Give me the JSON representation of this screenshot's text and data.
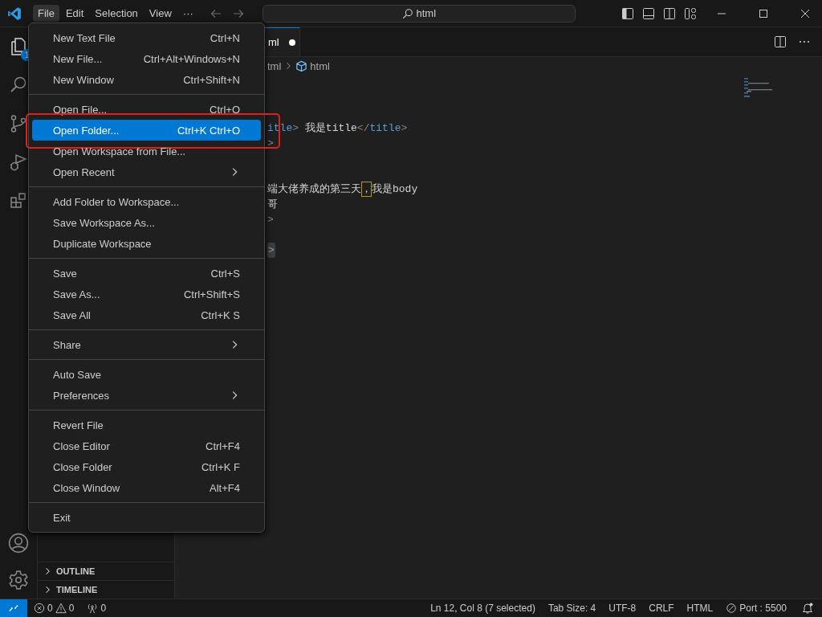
{
  "title_bar": {
    "menus": [
      {
        "label": "File",
        "selected": true
      },
      {
        "label": "Edit",
        "selected": false
      },
      {
        "label": "Selection",
        "selected": false
      },
      {
        "label": "View",
        "selected": false
      }
    ],
    "more": "···",
    "search": {
      "value": "html"
    }
  },
  "activity_bar": {
    "explorer_badge": "1"
  },
  "sidebar": {
    "sections": [
      {
        "label": "OUTLINE",
        "expanded": false
      },
      {
        "label": "TIMELINE",
        "expanded": false
      }
    ]
  },
  "editor": {
    "tab": {
      "label": "ml",
      "modified": true
    },
    "breadcrumb": [
      "tml",
      "html"
    ],
    "lines": [
      {
        "tokens": [
          {
            "text": "itle",
            "kind": "tag"
          },
          {
            "text": ">",
            "kind": "punct"
          },
          {
            "text": " 我是title",
            "kind": "text"
          },
          {
            "text": "</",
            "kind": "punct"
          },
          {
            "text": "title",
            "kind": "tag"
          },
          {
            "text": ">",
            "kind": "punct"
          }
        ]
      },
      {
        "tokens": [
          {
            "text": ">",
            "kind": "punct"
          }
        ]
      },
      {
        "tokens": [
          {
            "text": "端大佬养成的第三天",
            "kind": "text"
          },
          {
            "text": "，",
            "kind": "match"
          },
          {
            "text": "我是body",
            "kind": "text"
          }
        ]
      },
      {
        "tokens": [
          {
            "text": "哥",
            "kind": "text"
          }
        ]
      },
      {
        "tokens": [
          {
            "text": ">",
            "kind": "punct"
          }
        ]
      },
      {
        "tokens": [
          {
            "text": ">",
            "kind": "fold"
          }
        ]
      }
    ]
  },
  "file_menu": {
    "items": [
      {
        "kind": "item",
        "label": "New Text File",
        "shortcut": "Ctrl+N",
        "submenu": false,
        "selected": false,
        "outlined": false
      },
      {
        "kind": "item",
        "label": "New File...",
        "shortcut": "Ctrl+Alt+Windows+N",
        "submenu": false,
        "selected": false,
        "outlined": false
      },
      {
        "kind": "item",
        "label": "New Window",
        "shortcut": "Ctrl+Shift+N",
        "submenu": false,
        "selected": false,
        "outlined": false
      },
      {
        "kind": "separator"
      },
      {
        "kind": "item",
        "label": "Open File...",
        "shortcut": "Ctrl+O",
        "submenu": false,
        "selected": false,
        "outlined": false
      },
      {
        "kind": "item",
        "label": "Open Folder...",
        "shortcut": "Ctrl+K Ctrl+O",
        "submenu": false,
        "selected": true,
        "outlined": true
      },
      {
        "kind": "item",
        "label": "Open Workspace from File...",
        "submenu": false,
        "selected": false,
        "outlined": false
      },
      {
        "kind": "item",
        "label": "Open Recent",
        "submenu": true,
        "selected": false,
        "outlined": false
      },
      {
        "kind": "separator"
      },
      {
        "kind": "item",
        "label": "Add Folder to Workspace...",
        "submenu": false,
        "selected": false,
        "outlined": false
      },
      {
        "kind": "item",
        "label": "Save Workspace As...",
        "submenu": false,
        "selected": false,
        "outlined": false
      },
      {
        "kind": "item",
        "label": "Duplicate Workspace",
        "submenu": false,
        "selected": false,
        "outlined": false
      },
      {
        "kind": "separator"
      },
      {
        "kind": "item",
        "label": "Save",
        "shortcut": "Ctrl+S",
        "submenu": false,
        "selected": false,
        "outlined": false
      },
      {
        "kind": "item",
        "label": "Save As...",
        "shortcut": "Ctrl+Shift+S",
        "submenu": false,
        "selected": false,
        "outlined": false
      },
      {
        "kind": "item",
        "label": "Save All",
        "shortcut": "Ctrl+K S",
        "submenu": false,
        "selected": false,
        "outlined": false
      },
      {
        "kind": "separator"
      },
      {
        "kind": "item",
        "label": "Share",
        "submenu": true,
        "selected": false,
        "outlined": false
      },
      {
        "kind": "separator"
      },
      {
        "kind": "item",
        "label": "Auto Save",
        "submenu": false,
        "selected": false,
        "outlined": false
      },
      {
        "kind": "item",
        "label": "Preferences",
        "submenu": true,
        "selected": false,
        "outlined": false
      },
      {
        "kind": "separator"
      },
      {
        "kind": "item",
        "label": "Revert File",
        "submenu": false,
        "selected": false,
        "outlined": false
      },
      {
        "kind": "item",
        "label": "Close Editor",
        "shortcut": "Ctrl+F4",
        "submenu": false,
        "selected": false,
        "outlined": false
      },
      {
        "kind": "item",
        "label": "Close Folder",
        "shortcut": "Ctrl+K F",
        "submenu": false,
        "selected": false,
        "outlined": false
      },
      {
        "kind": "item",
        "label": "Close Window",
        "shortcut": "Alt+F4",
        "submenu": false,
        "selected": false,
        "outlined": false
      },
      {
        "kind": "separator"
      },
      {
        "kind": "item",
        "label": "Exit",
        "submenu": false,
        "selected": false,
        "outlined": false
      }
    ]
  },
  "status_bar": {
    "errors": "0",
    "warnings": "0",
    "ports": "0",
    "right": [
      {
        "text": "Ln 12, Col 8 (7 selected)",
        "kind": "text"
      },
      {
        "text": "Tab Size: 4",
        "kind": "text"
      },
      {
        "text": "UTF-8",
        "kind": "text"
      },
      {
        "text": "CRLF",
        "kind": "text"
      },
      {
        "text": "HTML",
        "kind": "text"
      },
      {
        "text": "Port : 5500",
        "kind": "port"
      }
    ]
  }
}
